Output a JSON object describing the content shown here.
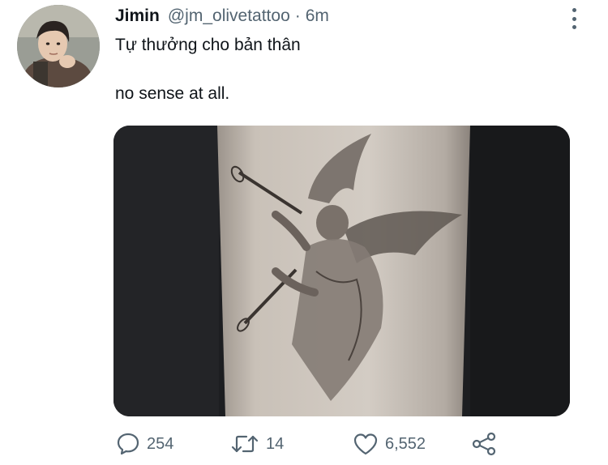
{
  "tweet": {
    "author_name": "Jimin",
    "handle": "@jm_olivetattoo",
    "separator": "·",
    "time": "6m",
    "text_line1": "Tự thưởng cho bản thân",
    "text_line2": "no sense at all."
  },
  "actions": {
    "replies": "254",
    "retweets": "14",
    "likes": "6,552"
  },
  "icons": {
    "reply": "speech-bubble-icon",
    "retweet": "retweet-arrows-icon",
    "like": "heart-icon",
    "share": "share-icon",
    "more": "vertical-ellipsis-icon"
  },
  "colors": {
    "text": "#0f1419",
    "secondary": "#536471",
    "media_bg": "#1b1c1e"
  }
}
